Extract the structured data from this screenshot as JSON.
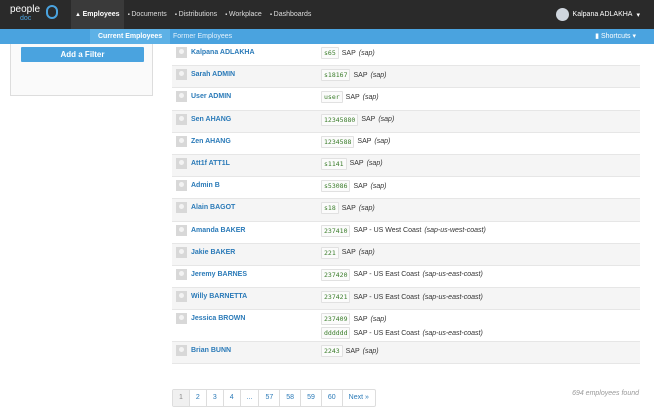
{
  "brand": {
    "name": "people",
    "sub": "doc"
  },
  "nav": [
    {
      "label": "Employees",
      "icon": "user-icon"
    },
    {
      "label": "Documents",
      "icon": "document-icon"
    },
    {
      "label": "Distributions",
      "icon": "envelope-icon"
    },
    {
      "label": "Workplace",
      "icon": "folder-icon"
    },
    {
      "label": "Dashboards",
      "icon": "chart-icon"
    }
  ],
  "user": {
    "name": "Kalpana ADLAKHA"
  },
  "subnav": {
    "current": "Current Employees",
    "former": "Former Employees",
    "shortcuts": "Shortcuts"
  },
  "sidebar": {
    "add_filter": "Add a Filter"
  },
  "employees": [
    {
      "name": "Kalpana ADLAKHA",
      "orgs": [
        {
          "code": "s65",
          "org": "SAP",
          "slug": "(sap)"
        }
      ]
    },
    {
      "name": "Sarah ADMIN",
      "orgs": [
        {
          "code": "s18167",
          "org": "SAP",
          "slug": "(sap)"
        }
      ]
    },
    {
      "name": "User ADMIN",
      "orgs": [
        {
          "code": "user",
          "org": "SAP",
          "slug": "(sap)"
        }
      ]
    },
    {
      "name": "Sen AHANG",
      "orgs": [
        {
          "code": "12345880",
          "org": "SAP",
          "slug": "(sap)"
        }
      ]
    },
    {
      "name": "Zen AHANG",
      "orgs": [
        {
          "code": "1234588",
          "org": "SAP",
          "slug": "(sap)"
        }
      ]
    },
    {
      "name": "Att1f ATT1L",
      "orgs": [
        {
          "code": "s1141",
          "org": "SAP",
          "slug": "(sap)"
        }
      ]
    },
    {
      "name": "Admin B",
      "orgs": [
        {
          "code": "s53086",
          "org": "SAP",
          "slug": "(sap)"
        }
      ]
    },
    {
      "name": "Alain BAGOT",
      "orgs": [
        {
          "code": "s18",
          "org": "SAP",
          "slug": "(sap)"
        }
      ]
    },
    {
      "name": "Amanda BAKER",
      "orgs": [
        {
          "code": "237410",
          "org": "SAP - US West Coast",
          "slug": "(sap-us-west-coast)"
        }
      ]
    },
    {
      "name": "Jakie BAKER",
      "orgs": [
        {
          "code": "221",
          "org": "SAP",
          "slug": "(sap)"
        }
      ]
    },
    {
      "name": "Jeremy BARNES",
      "orgs": [
        {
          "code": "237420",
          "org": "SAP - US East Coast",
          "slug": "(sap-us-east-coast)"
        }
      ]
    },
    {
      "name": "Willy BARNETTA",
      "orgs": [
        {
          "code": "237421",
          "org": "SAP - US East Coast",
          "slug": "(sap-us-east-coast)"
        }
      ]
    },
    {
      "name": "Jessica BROWN",
      "orgs": [
        {
          "code": "237409",
          "org": "SAP",
          "slug": "(sap)"
        },
        {
          "code": "dddddd",
          "org": "SAP - US East Coast",
          "slug": "(sap-us-east-coast)"
        }
      ]
    },
    {
      "name": "Brian BUNN",
      "orgs": [
        {
          "code": "2243",
          "org": "SAP",
          "slug": "(sap)"
        }
      ]
    }
  ],
  "pagination": [
    "1",
    "2",
    "3",
    "4",
    "...",
    "57",
    "58",
    "59",
    "60",
    "Next »"
  ],
  "found": "694 employees found"
}
